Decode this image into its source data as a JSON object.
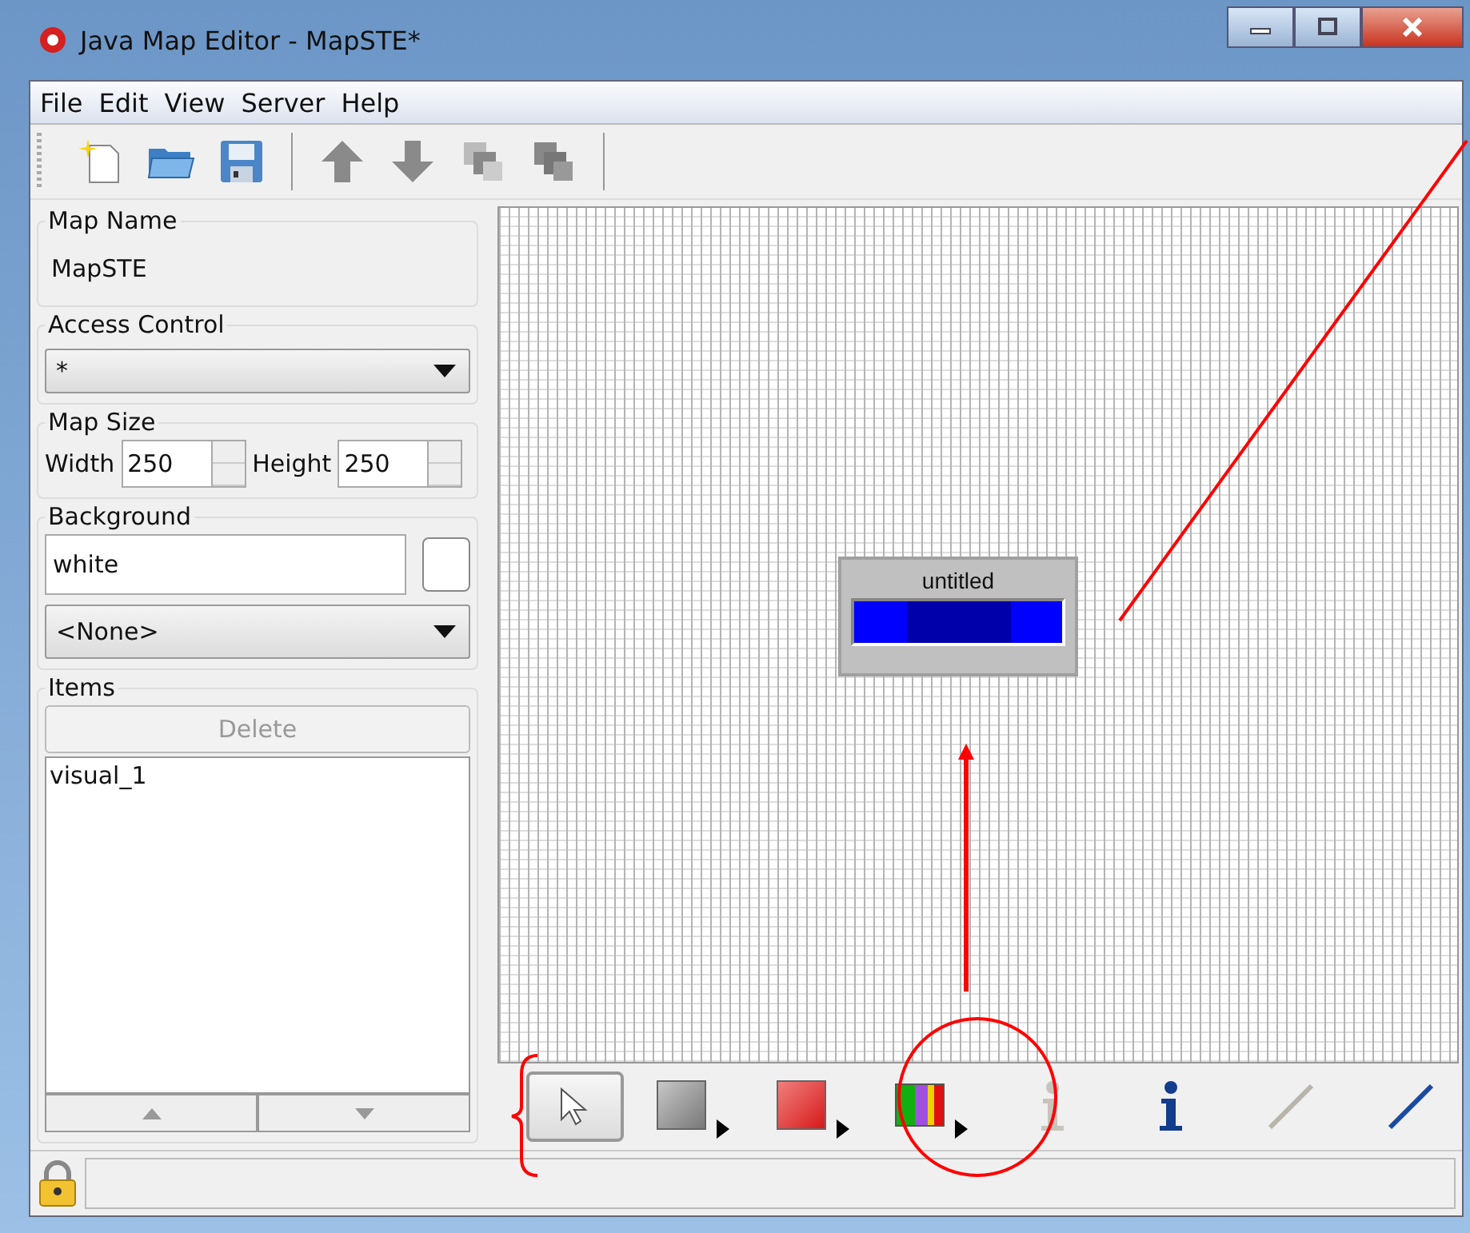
{
  "window": {
    "title": "Java Map Editor - MapSTE*"
  },
  "menu": [
    "File",
    "Edit",
    "View",
    "Server",
    "Help"
  ],
  "toolbar": [
    {
      "kind": "new"
    },
    {
      "kind": "open"
    },
    {
      "kind": "save"
    },
    {
      "kind": "separator"
    },
    {
      "kind": "up"
    },
    {
      "kind": "down"
    },
    {
      "kind": "front"
    },
    {
      "kind": "back"
    },
    {
      "kind": "separator"
    }
  ],
  "map_name": {
    "legend": "Map Name",
    "value": "MapSTE"
  },
  "access_control": {
    "legend": "Access Control",
    "value": "*"
  },
  "map_size": {
    "legend": "Map Size",
    "width_label": "Width",
    "width_value": "250",
    "height_label": "Height",
    "height_value": "250"
  },
  "background": {
    "legend": "Background",
    "value": "white",
    "image": "<None>"
  },
  "items": {
    "legend": "Items",
    "delete_button": {
      "label": "Delete",
      "disabled": true
    },
    "list": [
      {
        "label": "visual_1",
        "selected": false
      }
    ]
  },
  "canvas": {
    "widget": {
      "title": "untitled"
    }
  },
  "tools": [
    {
      "kind": "pointer",
      "selected": true
    },
    {
      "kind": "gray-box",
      "selected": false
    },
    {
      "kind": "red-box",
      "selected": false
    },
    {
      "kind": "color-bar",
      "selected": false
    },
    {
      "kind": "info",
      "selected": false,
      "disabled": true
    },
    {
      "kind": "info",
      "selected": false,
      "disabled": false
    },
    {
      "kind": "line",
      "selected": false,
      "disabled": true
    },
    {
      "kind": "line",
      "selected": false,
      "disabled": false
    }
  ]
}
